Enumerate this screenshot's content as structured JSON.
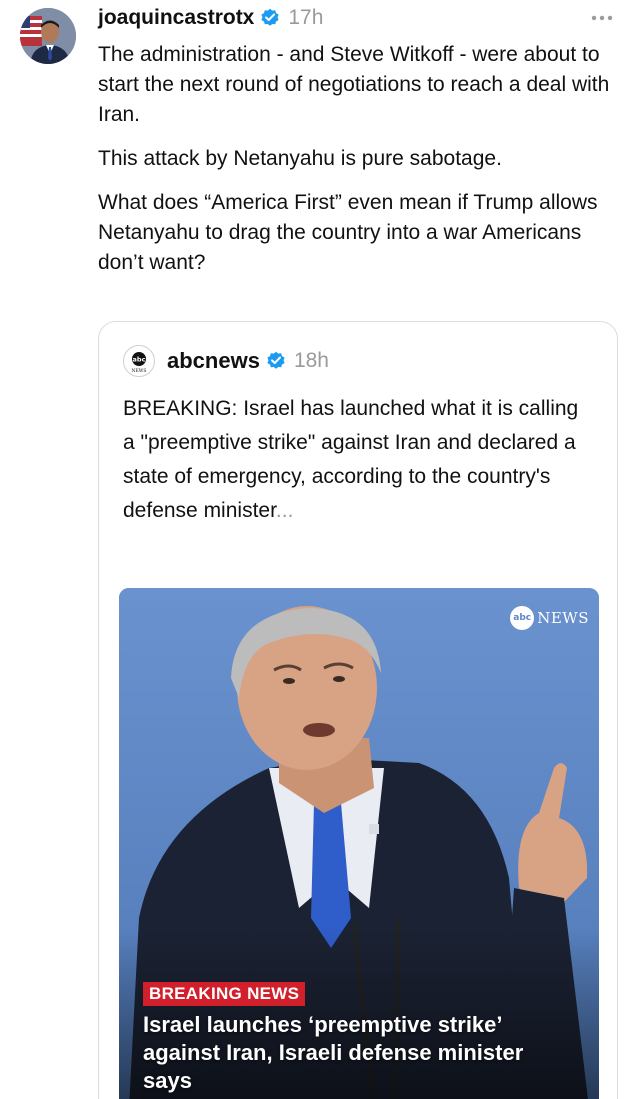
{
  "post": {
    "username": "joaquincastrotx",
    "timestamp": "17h",
    "paragraphs": [
      "The administration - and Steve Witkoff - were about to start the next round of negotiations to reach a deal with Iran.",
      "This attack by Netanyahu is pure sabotage.",
      "What does “America First” even mean if Trump allows Netanyahu to drag the country into a war Americans don’t want?"
    ],
    "more_icon": "ellipsis-icon",
    "verified_icon": "verified-badge-icon"
  },
  "quote": {
    "username": "abcnews",
    "timestamp": "18h",
    "text": "BREAKING: Israel has launched what it is calling a \"preemptive strike\" against Iran and declared a state of emergency, according to the country's defense minister",
    "ellipsis": "...",
    "logo_text": "abc",
    "logo_subtext": "NEWS",
    "media": {
      "watermark_logo": "abc",
      "watermark_word": "NEWS",
      "breaking_label": "BREAKING NEWS",
      "headline": "Israel launches ‘preemptive strike’ against Iran, Israeli defense minister says"
    }
  },
  "colors": {
    "verified": "#1d9bf0",
    "breaking_red": "#d1202c",
    "backdrop_blue": "#5e88c7",
    "muted_text": "#9a9a9a"
  }
}
